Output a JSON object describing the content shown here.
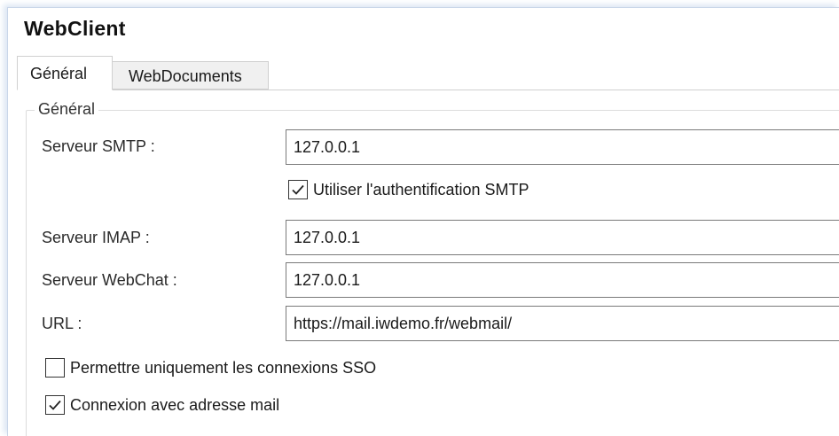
{
  "window": {
    "title": "WebClient"
  },
  "tabs": [
    {
      "label": "Général",
      "active": true
    },
    {
      "label": "WebDocuments",
      "active": false
    }
  ],
  "group": {
    "title": "Général"
  },
  "fields": {
    "smtp": {
      "label": "Serveur SMTP :",
      "value": "127.0.0.1"
    },
    "smtp_auth": {
      "label": "Utiliser l'authentification SMTP",
      "checked": true
    },
    "imap": {
      "label": "Serveur IMAP :",
      "value": "127.0.0.1"
    },
    "webchat": {
      "label": "Serveur WebChat :",
      "value": "127.0.0.1"
    },
    "url": {
      "label": "URL :",
      "value": "https://mail.iwdemo.fr/webmail/"
    }
  },
  "options": {
    "sso_only": {
      "label": "Permettre uniquement les connexions SSO",
      "checked": false
    },
    "login_email": {
      "label": "Connexion avec adresse mail",
      "checked": true
    }
  },
  "icons": {
    "check": "checkmark-icon"
  },
  "colors": {
    "accent_border": "#c9d6e8",
    "input_border": "#7a7a7a"
  }
}
